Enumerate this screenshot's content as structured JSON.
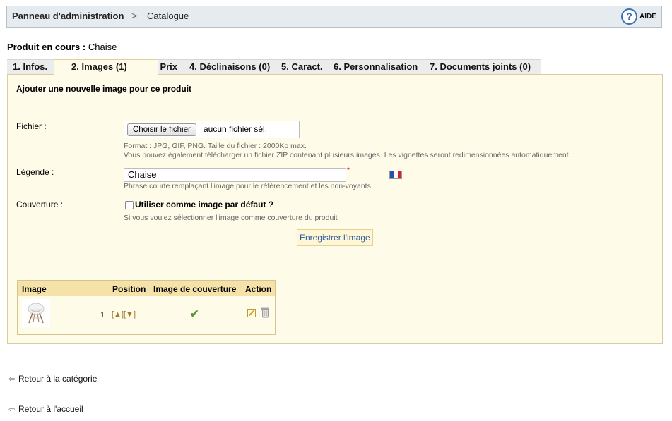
{
  "header": {
    "breadcrumb_root": "Panneau d'administration",
    "breadcrumb_sep": ">",
    "breadcrumb_current": "Catalogue",
    "help_label": "AIDE",
    "help_icon": "question-icon"
  },
  "product": {
    "label": "Produit en cours :",
    "name": "Chaise"
  },
  "tabs": [
    {
      "label": "1. Infos."
    },
    {
      "label": "2. Images (1)",
      "active": true
    },
    {
      "label": "3. Prix"
    },
    {
      "label": "4. Déclinaisons (0)"
    },
    {
      "label": "5. Caract."
    },
    {
      "label": "6. Personnalisation"
    },
    {
      "label": "7. Documents joints (0)"
    }
  ],
  "form": {
    "title": "Ajouter une nouvelle image pour ce produit",
    "file_label": "Fichier :",
    "file_button": "Choisir le fichier",
    "file_status": "aucun fichier sél.",
    "file_hint_1": "Format : JPG, GIF, PNG. Taille du fichier : 2000Ko max.",
    "file_hint_2": "Vous pouvez également télécharger un fichier ZIP contenant plusieurs images. Les vignettes seront redimensionnées automatiquement.",
    "legend_label": "Légende :",
    "legend_value": "Chaise",
    "legend_required": "*",
    "legend_hint": "Phrase courte remplaçant l'image pour le référencement et les non-voyants",
    "cover_label": "Couverture :",
    "cover_checkbox_label": "Utiliser comme image par défaut ?",
    "cover_hint": "Si vous voulez sélectionner l'image comme couverture du produit",
    "save_button": "Enregistrer l'image"
  },
  "image_table": {
    "headers": [
      "Image",
      "Position",
      "Image de couverture",
      "Action"
    ],
    "rows": [
      {
        "position": "1",
        "position_controls": "[▲][▼]",
        "is_cover": true
      }
    ]
  },
  "links": {
    "back_category": "Retour à la catégorie",
    "back_home": "Retour à l'accueil"
  },
  "colors": {
    "panel_bg": "#fffbe9",
    "table_header_bg": "#f4e2a9",
    "link_blue": "#2a5d9f"
  }
}
